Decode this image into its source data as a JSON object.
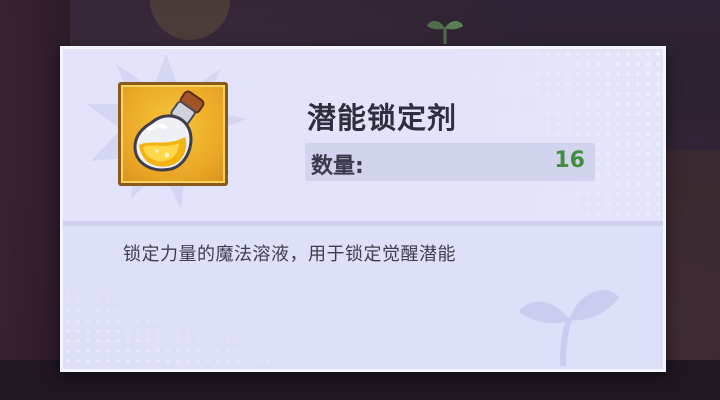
{
  "item": {
    "name": "潜能锁定剂",
    "quantity_label": "数量:",
    "quantity_value": "16",
    "description": "锁定力量的魔法溶液，用于锁定觉醒潜能",
    "icon": "golden-potion-bottle-icon"
  },
  "colors": {
    "card_background": "#dedff8",
    "quantity_value": "#3f8f3c",
    "icon_frame": "#e9a524"
  }
}
